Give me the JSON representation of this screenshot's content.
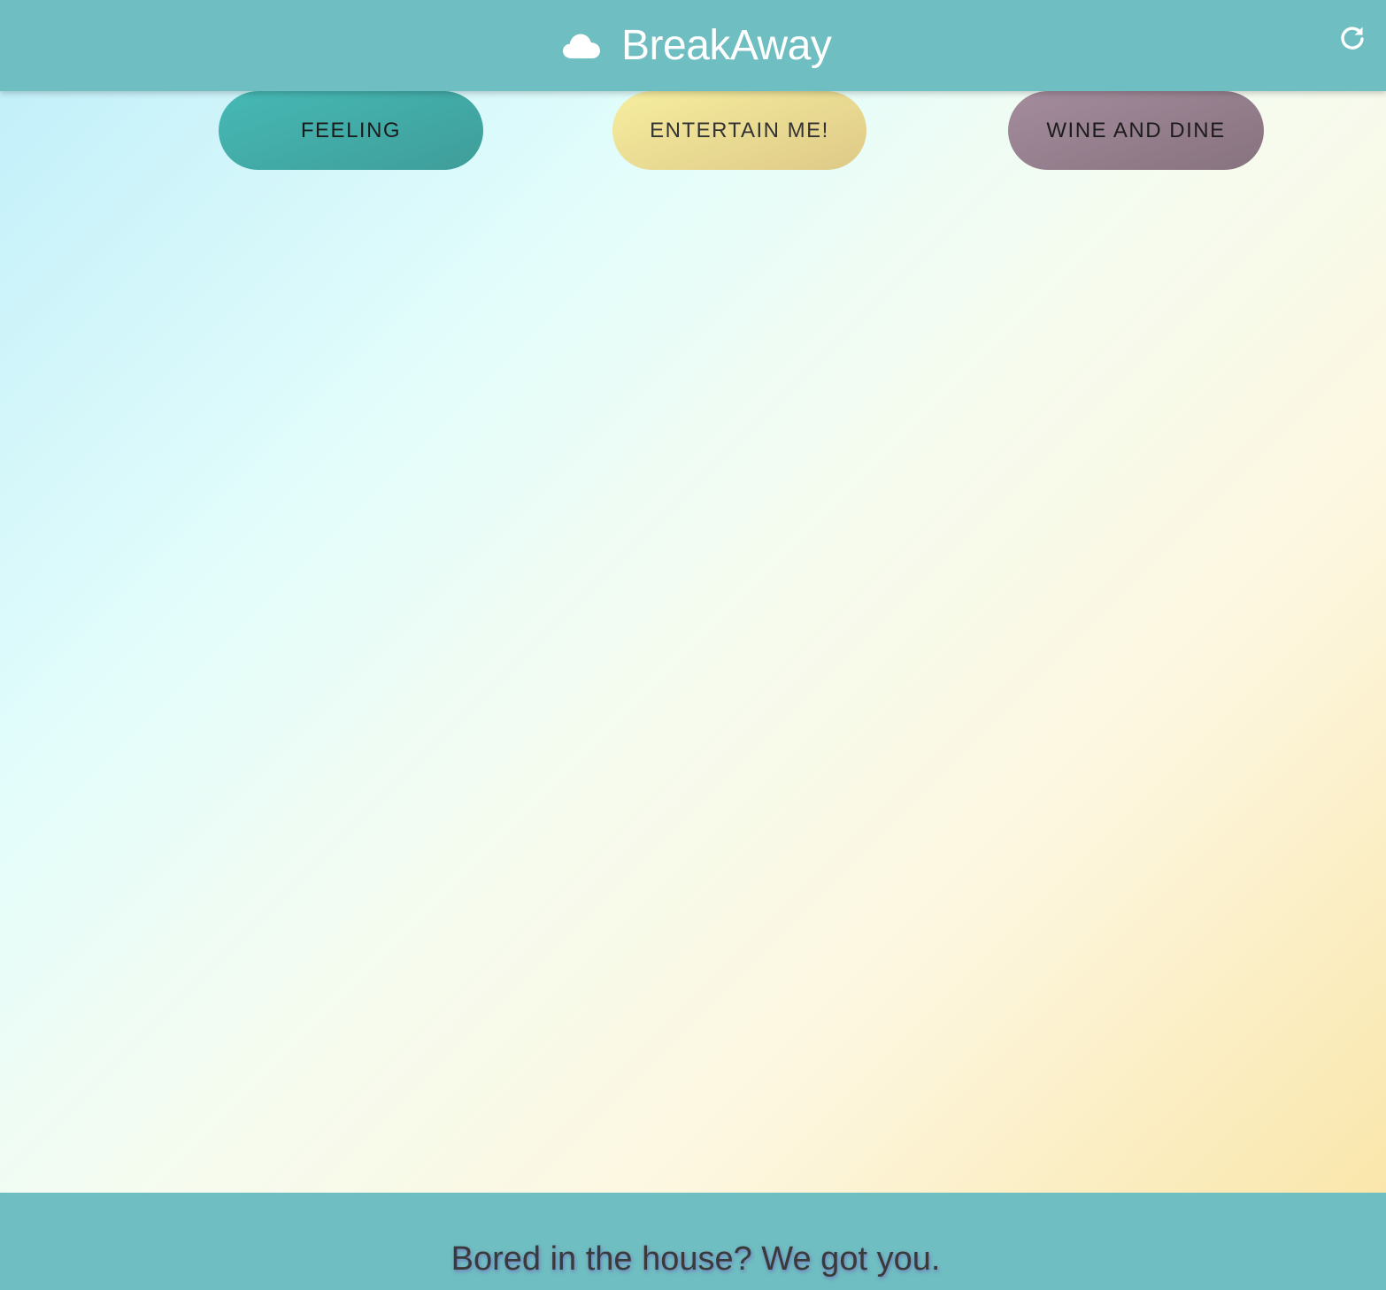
{
  "header": {
    "title": "BreakAway",
    "logo_icon": "cloud-icon",
    "refresh_icon": "refresh-icon",
    "background_color": "#6fbec1"
  },
  "nav": {
    "buttons": [
      {
        "label": "FEELING",
        "color": "#44b1ad"
      },
      {
        "label": "ENTERTAIN ME!",
        "color": "#ece08f"
      },
      {
        "label": "WINE AND DINE",
        "color": "#958090"
      }
    ]
  },
  "footer": {
    "tagline": "Bored in the house? We got you."
  }
}
